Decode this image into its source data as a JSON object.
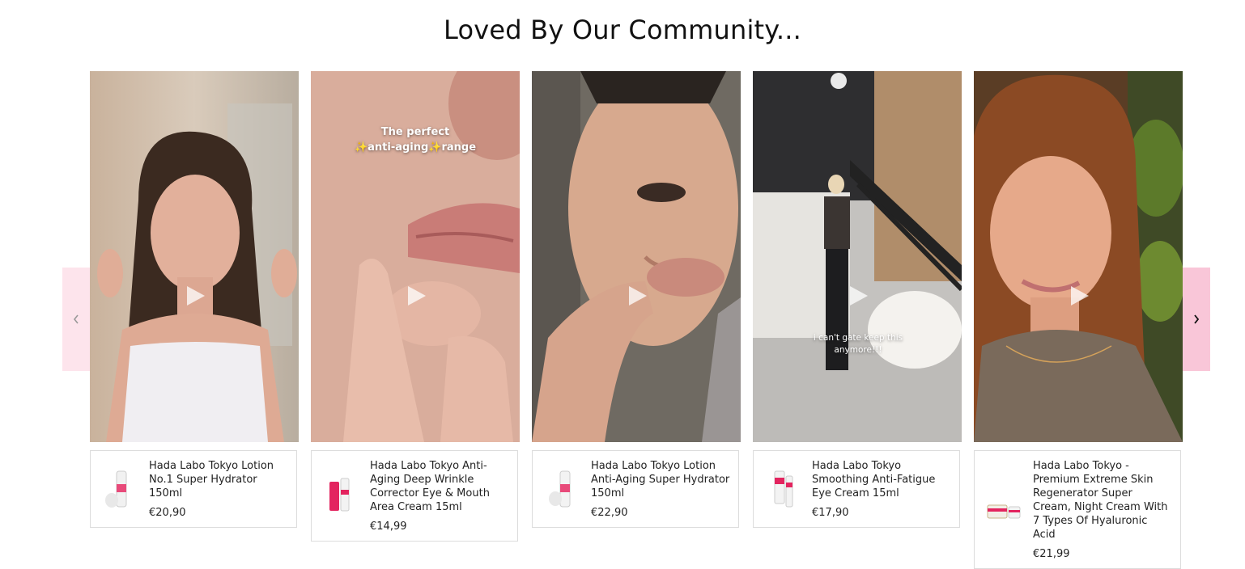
{
  "section": {
    "title": "Loved By Our Community..."
  },
  "nav": {
    "prev_icon": "chevron-left-icon",
    "next_icon": "chevron-right-icon"
  },
  "cards": [
    {
      "overlay": [],
      "product": {
        "name": "Hada Labo Tokyo Lotion No.1 Super Hydrator 150ml",
        "price": "€20,90"
      }
    },
    {
      "overlay": [
        "The perfect",
        "✨anti-aging✨range"
      ],
      "product": {
        "name": "Hada Labo Tokyo Anti-Aging Deep Wrinkle Corrector Eye & Mouth Area Cream 15ml",
        "price": "€14,99"
      }
    },
    {
      "overlay": [],
      "product": {
        "name": "Hada Labo Tokyo Lotion Anti-Aging Super Hydrator 150ml",
        "price": "€22,90"
      }
    },
    {
      "overlay": [
        "i can't gate keep this",
        "anymore!!!"
      ],
      "product": {
        "name": "Hada Labo Tokyo Smoothing Anti-Fatigue Eye Cream 15ml",
        "price": "€17,90"
      }
    },
    {
      "overlay": [],
      "product": {
        "name": "Hada Labo Tokyo - Premium Extreme Skin Regenerator Super Cream, Night Cream With 7 Types Of Hyaluronic Acid",
        "price": "€21,99"
      }
    }
  ]
}
